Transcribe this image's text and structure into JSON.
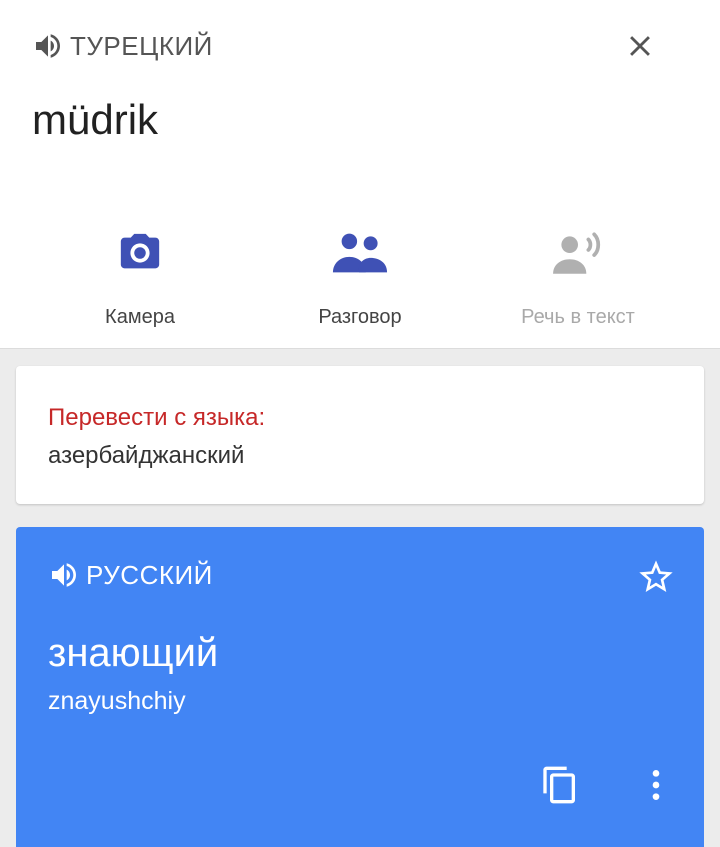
{
  "source": {
    "language_label": "ТУРЕЦКИЙ",
    "text": "müdrik"
  },
  "tools": [
    {
      "label": "Камера",
      "icon": "camera-icon",
      "enabled": true
    },
    {
      "label": "Разговор",
      "icon": "conversation-icon",
      "enabled": true
    },
    {
      "label": "Речь в текст",
      "icon": "speech-to-text-icon",
      "enabled": false
    }
  ],
  "detect": {
    "title": "Перевести с языка:",
    "language": "азербайджанский"
  },
  "result": {
    "language_label": "РУССКИЙ",
    "translation": "знающий",
    "transliteration": "znayushchiy"
  },
  "colors": {
    "accent": "#4285f4",
    "tool_icon": "#3f51b5",
    "detect_title": "#c62828",
    "disabled": "#b0b0b0"
  }
}
